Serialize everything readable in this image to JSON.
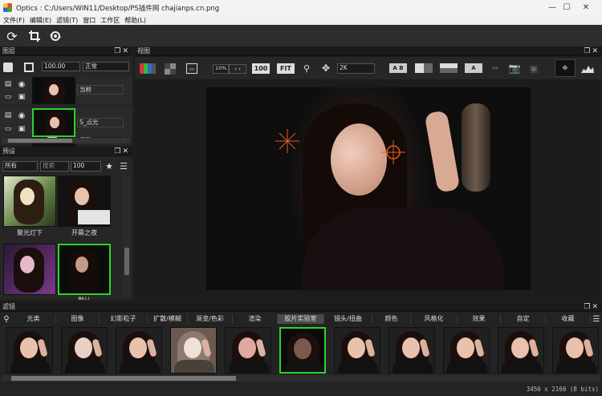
{
  "window": {
    "title": "Optics : C:/Users/WIN11/Desktop/PS插件网 chajianps.cn.png",
    "minimize": "—",
    "maximize": "☐",
    "close": "✕"
  },
  "menu": [
    "文件(F)",
    "编辑(E)",
    "滤镜(T)",
    "窗口",
    "工作区",
    "帮助(L)"
  ],
  "layers": {
    "title": "图层",
    "opacity": "100.00",
    "blend": "正常",
    "layer1_name": "当前",
    "layer2_name": "S_点光"
  },
  "presets": {
    "title": "预设",
    "category": "所有",
    "search_placeholder": "搜索",
    "amount": "100",
    "items": [
      "聚光灯下",
      "开幕之夜",
      "",
      "默认"
    ]
  },
  "view": {
    "title": "视图",
    "zoom_pct": "10%",
    "zoom_100": "100",
    "fit": "FIT",
    "resolution": "2K",
    "ab": "A B",
    "status": "3456 x 2160 (8 bits)"
  },
  "filters": {
    "title": "滤镜",
    "tabs": [
      "光类",
      "图像",
      "幻影粒子",
      "扩散/模糊",
      "渐变/色彩",
      "渲染",
      "胶片实验室",
      "镜头/扭曲",
      "颜色",
      "风格化",
      "效果",
      "自定",
      "收藏"
    ]
  },
  "colors": {
    "accent": "#2bd42b",
    "crosshair": "#e25a20",
    "bg": "#1e1e1e"
  }
}
